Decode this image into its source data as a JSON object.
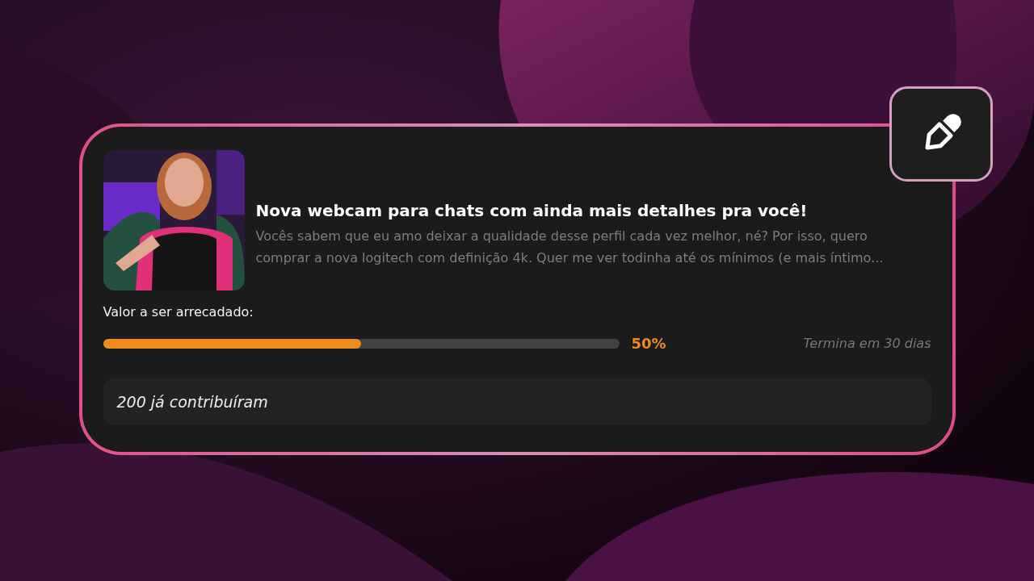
{
  "campaign": {
    "title": "Nova webcam para chats com ainda mais detalhes pra você!",
    "description": "Vocês sabem que eu amo deixar a qualidade desse perfil cada vez melhor, né? Por isso, quero comprar a nova logitech com definição 4k. Quer me ver todinha até os mínimos (e mais íntimo...",
    "goal_label": "Valor a ser arrecadado:",
    "progress": {
      "level": 0.5,
      "reading": "50%"
    },
    "ends": "Termina em 30 dias",
    "contributors": "200 já contribuíram"
  }
}
